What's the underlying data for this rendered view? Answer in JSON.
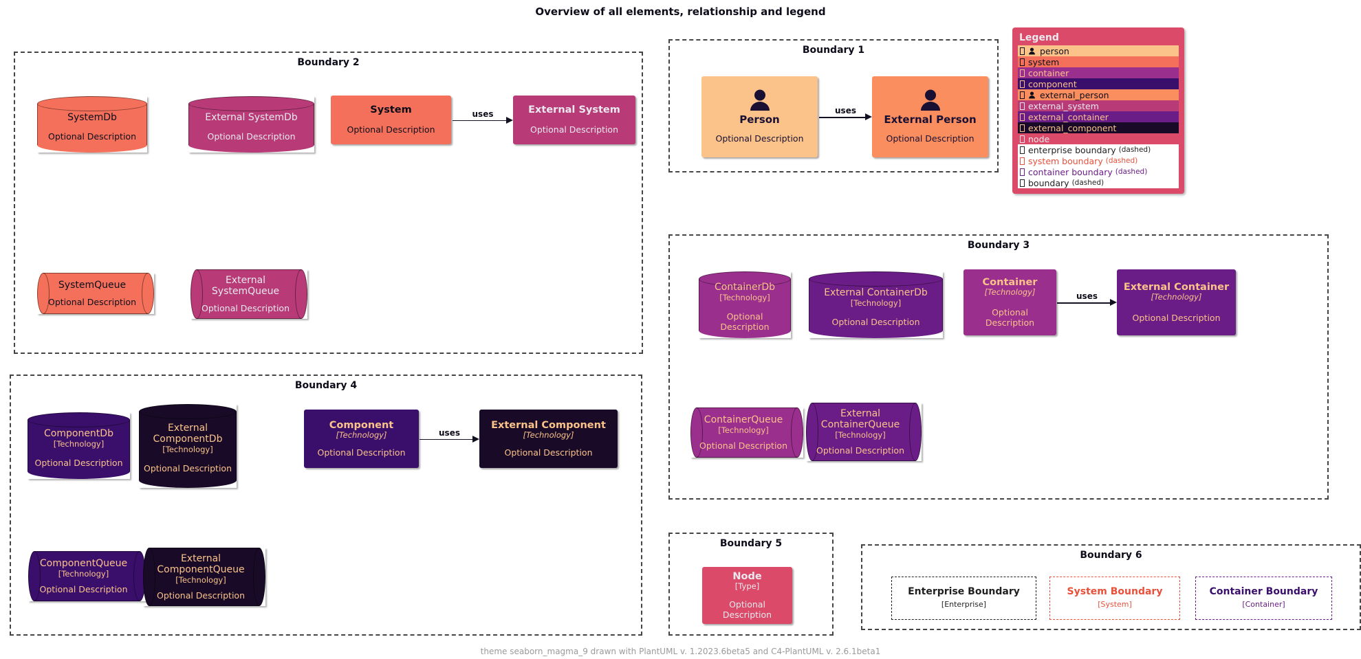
{
  "title": "Overview of all elements, relationship and legend",
  "footer": "theme seaborn_magma_9 drawn with PlantUML v. 1.2023.6beta5 and C4-PlantUML v. 2.6.1beta1",
  "colors": {
    "person": "#FBC38A",
    "external_person": "#FA8E5F",
    "system": "#F4705A",
    "external_system": "#B83B78",
    "container": "#9B2F8E",
    "external_container": "#6A1D86",
    "component": "#3A0F6B",
    "external_component": "#190B28",
    "node": "#DB4A68",
    "legend_bg": "#DB4A68",
    "boundary_default": "#444444",
    "boundary_system": "#E8503A",
    "boundary_container": "#6A1D86",
    "boundary_enterprise": "#1F1F1F",
    "text_dark": "#0D0D1A",
    "text_light": "#E9E9EF",
    "text_cream": "#FBC38A"
  },
  "boundaries": {
    "b1": {
      "label": "Boundary 1"
    },
    "b2": {
      "label": "Boundary 2"
    },
    "b3": {
      "label": "Boundary 3"
    },
    "b4": {
      "label": "Boundary 4"
    },
    "b5": {
      "label": "Boundary 5"
    },
    "b6": {
      "label": "Boundary 6"
    }
  },
  "elements": {
    "person": {
      "name": "Person",
      "desc": "Optional Description"
    },
    "external_person": {
      "name": "External Person",
      "desc": "Optional Description"
    },
    "system": {
      "name": "System",
      "desc": "Optional Description"
    },
    "external_system": {
      "name": "External System",
      "desc": "Optional Description"
    },
    "system_db": {
      "name": "SystemDb",
      "desc": "Optional Description"
    },
    "external_system_db": {
      "name": "External SystemDb",
      "desc": "Optional Description"
    },
    "system_queue": {
      "name": "SystemQueue",
      "desc": "Optional Description"
    },
    "external_system_queue": {
      "name": "External\nSystemQueue",
      "line1": "External",
      "line2": "SystemQueue",
      "desc": "Optional Description"
    },
    "container": {
      "name": "Container",
      "tech": "[Technology]",
      "desc": "Optional Description"
    },
    "external_container": {
      "name": "External Container",
      "tech": "[Technology]",
      "desc": "Optional Description"
    },
    "container_db": {
      "name": "ContainerDb",
      "tech": "[Technology]",
      "desc": "Optional Description"
    },
    "external_container_db": {
      "name": "External ContainerDb",
      "tech": "[Technology]",
      "desc": "Optional Description"
    },
    "container_queue": {
      "name": "ContainerQueue",
      "tech": "[Technology]",
      "desc": "Optional Description"
    },
    "external_container_queue": {
      "line1": "External",
      "line2": "ContainerQueue",
      "tech": "[Technology]",
      "desc": "Optional Description"
    },
    "component": {
      "name": "Component",
      "tech": "[Technology]",
      "desc": "Optional Description"
    },
    "external_component": {
      "name": "External Component",
      "tech": "[Technology]",
      "desc": "Optional Description"
    },
    "component_db": {
      "name": "ComponentDb",
      "tech": "[Technology]",
      "desc": "Optional Description"
    },
    "external_component_db": {
      "line1": "External",
      "line2": "ComponentDb",
      "tech": "[Technology]",
      "desc": "Optional Description"
    },
    "component_queue": {
      "name": "ComponentQueue",
      "tech": "[Technology]",
      "desc": "Optional Description"
    },
    "external_component_queue": {
      "line1": "External",
      "line2": "ComponentQueue",
      "tech": "[Technology]",
      "desc": "Optional Description"
    },
    "node": {
      "name": "Node",
      "tech": "[Type]",
      "desc": "Optional Description"
    },
    "enterprise_boundary": {
      "name": "Enterprise Boundary",
      "tech": "[Enterprise]"
    },
    "system_boundary": {
      "name": "System Boundary",
      "tech": "[System]"
    },
    "container_boundary": {
      "name": "Container Boundary",
      "tech": "[Container]"
    }
  },
  "relationships": {
    "person_uses": "uses",
    "system_uses": "uses",
    "container_uses": "uses",
    "component_uses": "uses"
  },
  "legend": {
    "title": "Legend",
    "rows": [
      {
        "label": "person",
        "sub": "",
        "bg": "#FBC38A",
        "fg": "#0D0D1A",
        "icon": "person-icon"
      },
      {
        "label": "system",
        "sub": "",
        "bg": "#F4705A",
        "fg": "#0D0D1A",
        "icon": ""
      },
      {
        "label": "container",
        "sub": "",
        "bg": "#9B2F8E",
        "fg": "#FBC38A",
        "icon": ""
      },
      {
        "label": "component",
        "sub": "",
        "bg": "#3A0F6B",
        "fg": "#FBC38A",
        "icon": ""
      },
      {
        "label": "external_person",
        "sub": "",
        "bg": "#FA8E5F",
        "fg": "#0D0D1A",
        "icon": "person-icon"
      },
      {
        "label": "external_system",
        "sub": "",
        "bg": "#B83B78",
        "fg": "#E9E9EF",
        "icon": ""
      },
      {
        "label": "external_container",
        "sub": "",
        "bg": "#6A1D86",
        "fg": "#FBC38A",
        "icon": ""
      },
      {
        "label": "external_component",
        "sub": "",
        "bg": "#190B28",
        "fg": "#FBC38A",
        "icon": ""
      },
      {
        "label": "node",
        "sub": "",
        "bg": "#DB4A68",
        "fg": "#E9E9EF",
        "icon": ""
      },
      {
        "label": "enterprise boundary",
        "sub": "(dashed)",
        "bg": "#FFFFFF",
        "fg": "#1F1F1F",
        "icon": ""
      },
      {
        "label": "system boundary",
        "sub": "(dashed)",
        "bg": "#FFFFFF",
        "fg": "#E8503A",
        "icon": ""
      },
      {
        "label": "container boundary",
        "sub": "(dashed)",
        "bg": "#FFFFFF",
        "fg": "#6A1D86",
        "icon": ""
      },
      {
        "label": "boundary",
        "sub": "(dashed)",
        "bg": "#FFFFFF",
        "fg": "#1F1F1F",
        "icon": ""
      }
    ]
  }
}
